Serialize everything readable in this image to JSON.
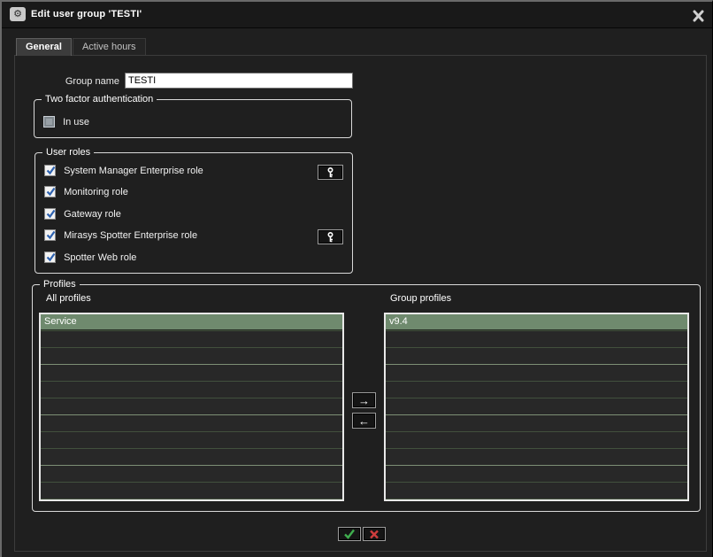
{
  "window": {
    "title": "Edit user group 'TESTI'",
    "titlebar_icon_glyph": "⚙"
  },
  "tabs": {
    "general": "General",
    "active_hours": "Active hours"
  },
  "general_tab": {
    "group_name_label": "Group name",
    "group_name_value": "TESTI",
    "two_factor": {
      "legend": "Two factor authentication",
      "in_use_label": "In use",
      "in_use_checked": false
    },
    "user_roles": {
      "legend": "User roles",
      "roles": [
        {
          "label": "System Manager Enterprise role",
          "checked": true,
          "key_button": true
        },
        {
          "label": "Monitoring role",
          "checked": true,
          "key_button": false
        },
        {
          "label": "Gateway role",
          "checked": true,
          "key_button": false
        },
        {
          "label": "Mirasys Spotter Enterprise role",
          "checked": true,
          "key_button": true
        },
        {
          "label": "Spotter Web role",
          "checked": true,
          "key_button": false
        }
      ]
    },
    "profiles": {
      "legend": "Profiles",
      "all_profiles_label": "All profiles",
      "all_profiles_items": [
        {
          "text": "Service",
          "selected": true
        }
      ],
      "group_profiles_label": "Group profiles",
      "group_profiles_items": [
        {
          "text": "v9.4",
          "selected": true
        }
      ],
      "move_right_glyph": "→",
      "move_left_glyph": "←"
    }
  },
  "colors": {
    "selected_row_green": "#6f8a6e",
    "check_blue": "#2e62b0",
    "ok_green": "#3fae4e",
    "cancel_red": "#cf3d3d",
    "titlebar_bg": "#191919",
    "panel_bg": "#1f1f1f"
  }
}
